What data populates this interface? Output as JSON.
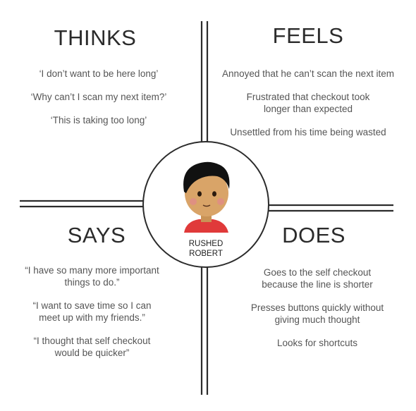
{
  "quadrants": {
    "thinks": {
      "title": "THINKS",
      "items": [
        "‘I don’t want to be here long’",
        "‘Why can’t I scan my next item?’",
        "‘This is taking too long’"
      ]
    },
    "feels": {
      "title": "FEELS",
      "items": [
        "Annoyed that he can’t scan the next item",
        "Frustrated that checkout took longer than expected",
        "Unsettled from his time being wasted"
      ]
    },
    "says": {
      "title": "SAYS",
      "items": [
        "“I have so many more important things to do.”",
        "“I want to save time so I can meet up with my friends.”",
        "“I thought that self checkout would be quicker”"
      ]
    },
    "does": {
      "title": "DOES",
      "items": [
        "Goes to the self checkout because the line is shorter",
        "Presses buttons quickly without giving much thought",
        "Looks for shortcuts"
      ]
    }
  },
  "persona": {
    "name_line1": "RUSHED",
    "name_line2": "ROBERT",
    "icon": "person-avatar-icon"
  },
  "colors": {
    "lines": "#2b2b2b",
    "skin": "#d9a468",
    "hair": "#111111",
    "shirt": "#e03a3a"
  }
}
